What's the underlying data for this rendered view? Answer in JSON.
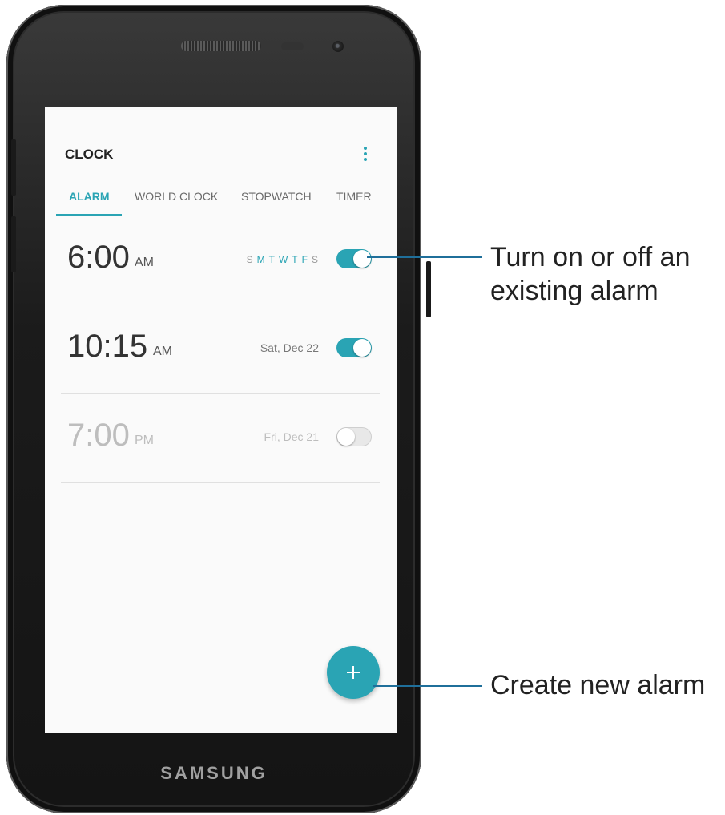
{
  "device": {
    "brand": "SAMSUNG"
  },
  "header": {
    "title": "CLOCK",
    "more_icon": "more-vert-icon"
  },
  "tabs": [
    {
      "label": "ALARM",
      "active": true
    },
    {
      "label": "WORLD CLOCK",
      "active": false
    },
    {
      "label": "STOPWATCH",
      "active": false
    },
    {
      "label": "TIMER",
      "active": false
    }
  ],
  "alarms": [
    {
      "time": "6:00",
      "ampm": "AM",
      "days": [
        "S",
        "M",
        "T",
        "W",
        "T",
        "F",
        "S"
      ],
      "days_active": [
        false,
        true,
        true,
        true,
        true,
        true,
        false
      ],
      "enabled": true
    },
    {
      "time": "10:15",
      "ampm": "AM",
      "date": "Sat, Dec 22",
      "enabled": true
    },
    {
      "time": "7:00",
      "ampm": "PM",
      "date": "Fri, Dec 21",
      "enabled": false
    }
  ],
  "fab": {
    "icon": "plus-icon"
  },
  "callouts": {
    "toggle": "Turn on or off an existing alarm",
    "toggle_line1": "Turn on or off an",
    "toggle_line2": "existing alarm",
    "create": "Create new alarm"
  },
  "colors": {
    "accent": "#2aa4b4",
    "callout_line": "#1f6f9a"
  }
}
